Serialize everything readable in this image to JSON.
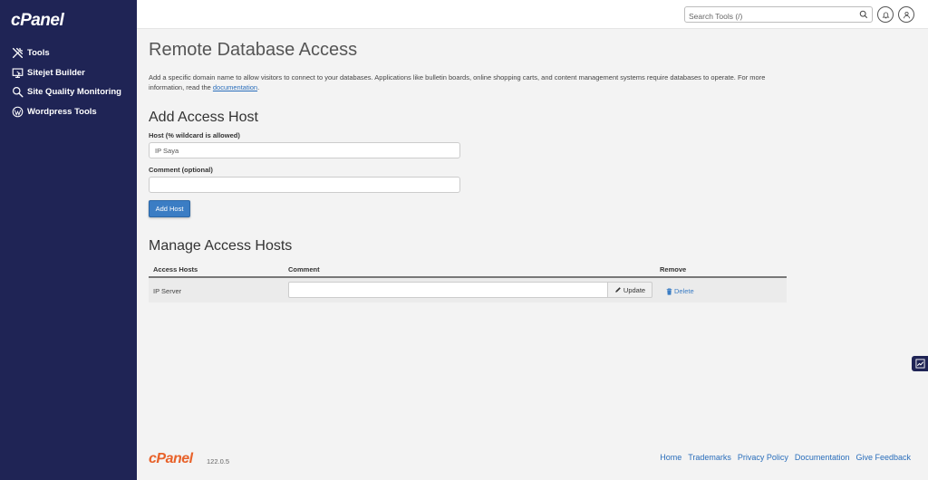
{
  "sidebar": {
    "logo": "cPanel",
    "items": [
      {
        "label": "Tools",
        "icon": "tools-icon"
      },
      {
        "label": "Sitejet Builder",
        "icon": "sitejet-icon"
      },
      {
        "label": "Site Quality Monitoring",
        "icon": "magnify-icon"
      },
      {
        "label": "Wordpress Tools",
        "icon": "wordpress-icon"
      }
    ]
  },
  "topbar": {
    "search_placeholder": "Search Tools (/)"
  },
  "page": {
    "title": "Remote Database Access",
    "description": "Add a specific domain name to allow visitors to connect to your databases. Applications like bulletin boards, online shopping carts, and content management systems require databases to operate. For more information, read the ",
    "doc_link": "documentation",
    "doc_suffix": "."
  },
  "add_host": {
    "heading": "Add Access Host",
    "host_label": "Host (% wildcard is allowed)",
    "host_value": "IP Saya",
    "comment_label": "Comment (optional)",
    "comment_value": "",
    "button": "Add Host"
  },
  "manage": {
    "heading": "Manage Access Hosts",
    "columns": [
      "Access Hosts",
      "Comment",
      "Remove"
    ],
    "rows": [
      {
        "host": "IP Server",
        "comment": "",
        "update": "Update",
        "delete": "Delete"
      }
    ]
  },
  "footer": {
    "logo": "cPanel",
    "version": "122.0.5",
    "links": [
      "Home",
      "Trademarks",
      "Privacy Policy",
      "Documentation",
      "Give Feedback"
    ]
  },
  "colors": {
    "sidebar": "#1f2455",
    "primary": "#3b7dc4",
    "brand_orange": "#e8622a"
  }
}
